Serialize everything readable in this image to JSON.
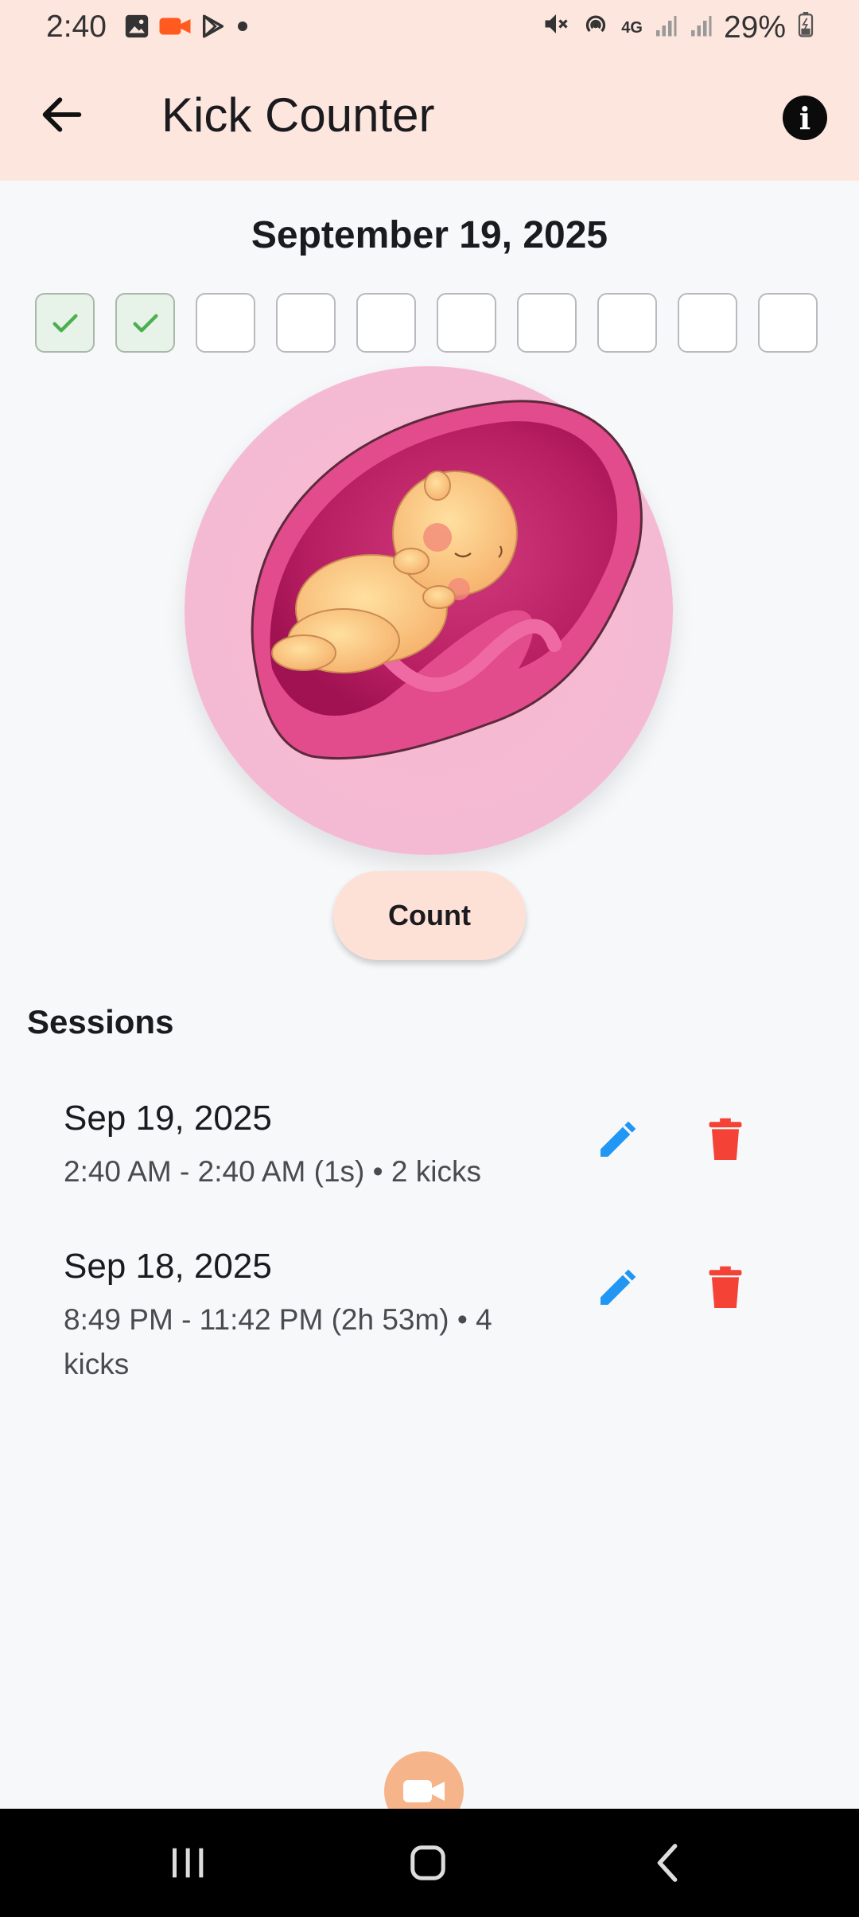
{
  "status_bar": {
    "time": "2:40",
    "battery": "29%",
    "network": "4G",
    "left_icons": [
      "gallery-icon",
      "video-recorder-icon",
      "play-store-icon",
      "dot-icon"
    ],
    "right_icons": [
      "mute-icon",
      "hotspot-icon",
      "network-4g-icon",
      "signal-icon",
      "signal-icon",
      "battery-icon"
    ]
  },
  "app_bar": {
    "title": "Kick Counter",
    "back_icon": "arrow-left-icon",
    "info_icon": "info-icon",
    "info_glyph": "i"
  },
  "date_title": "September 19, 2025",
  "kick_boxes": [
    {
      "checked": true
    },
    {
      "checked": true
    },
    {
      "checked": false
    },
    {
      "checked": false
    },
    {
      "checked": false
    },
    {
      "checked": false
    },
    {
      "checked": false
    },
    {
      "checked": false
    },
    {
      "checked": false
    },
    {
      "checked": false
    }
  ],
  "count_button": "Count",
  "sessions_title": "Sessions",
  "sessions": [
    {
      "date": "Sep 19, 2025",
      "detail": "2:40 AM - 2:40 AM (1s) • 2 kicks"
    },
    {
      "date": "Sep 18, 2025",
      "detail": "8:49 PM - 11:42 PM (2h 53m) • 4 kicks"
    }
  ],
  "colors": {
    "app_bar_bg": "#fde6de",
    "page_bg": "#f7f8fa",
    "check_green": "#4caf50",
    "edit_blue": "#2196f3",
    "delete_red": "#f44336",
    "count_button_bg": "#fde1d7"
  },
  "nav_bar": {
    "icons": [
      "recent-apps-icon",
      "home-icon",
      "back-icon"
    ]
  }
}
